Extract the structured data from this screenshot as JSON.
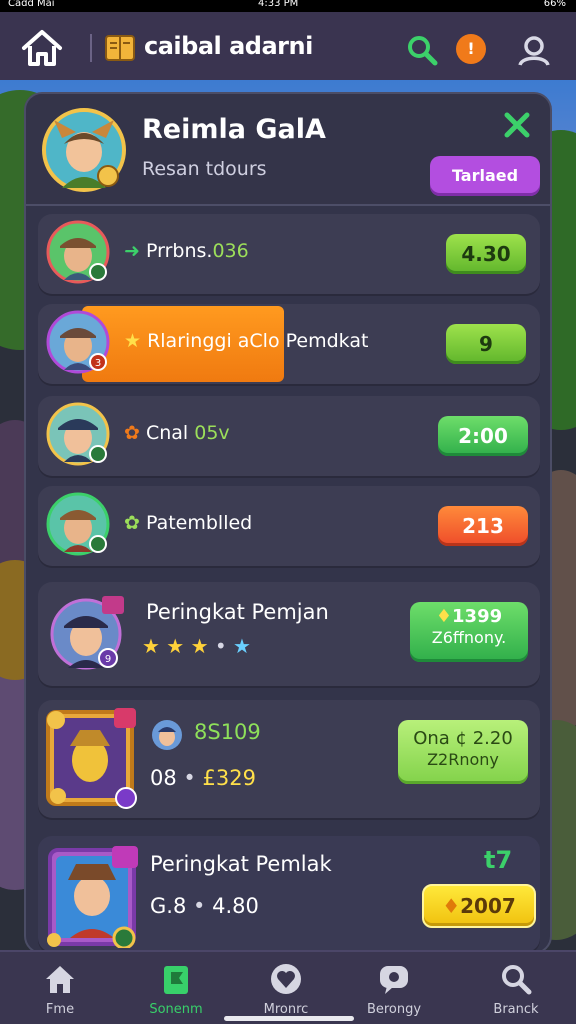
{
  "status_bar": {
    "carrier": "Cadd Mai",
    "time": "4:33 PM",
    "battery": "66%"
  },
  "app": {
    "title": "caibal adarni"
  },
  "header": {
    "title": "Reimla GalA",
    "subtitle": "Resan tdours",
    "action_label": "Tarlaed"
  },
  "rows": [
    {
      "label": "Prrbns.",
      "label_accent": "036",
      "value": "4.30",
      "badge": ""
    },
    {
      "label": "Rlaringgi aClo",
      "label_tail": "Pemdkat",
      "value": "9",
      "badge": "3"
    },
    {
      "label": "Cnal",
      "label_accent": "05v",
      "value": "2:00",
      "badge": ""
    },
    {
      "label": "Patemblled",
      "value": "213",
      "badge": ""
    },
    {
      "label": "Peringkat Pemjan",
      "value": "1399",
      "value_sub": "Z6ffnony.",
      "badge": "9"
    },
    {
      "line1": "8S109",
      "line2_a": "08",
      "line2_b": "£329",
      "value": "Ona ¢ 2.20",
      "value_sub": "Z2Rnony"
    },
    {
      "label": "Peringkat Pemlak",
      "line2_a": "G.8",
      "line2_b": "4.80",
      "corner": "t7",
      "value": "2007"
    }
  ],
  "nav": [
    {
      "label": "Fme",
      "icon": "home-icon"
    },
    {
      "label": "Sonenm",
      "icon": "flag-icon"
    },
    {
      "label": "Mronrc",
      "icon": "heart-icon"
    },
    {
      "label": "Berongy",
      "icon": "chat-icon"
    },
    {
      "label": "Branck",
      "icon": "search-icon"
    }
  ],
  "colors": {
    "accent_green": "#38d06a",
    "accent_purple": "#b34ee0",
    "panel": "#33344a"
  }
}
